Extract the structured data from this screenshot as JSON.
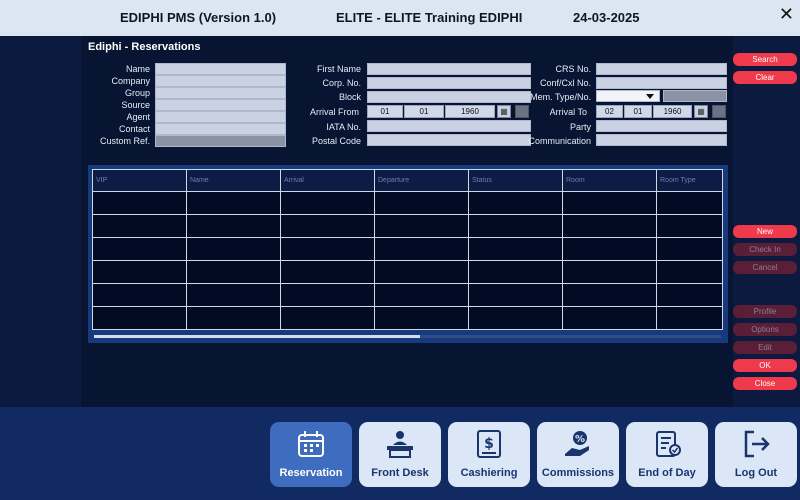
{
  "header": {
    "app": "EDIPHI PMS (Version 1.0)",
    "hotel": "ELITE - ELITE Training EDIPHI",
    "date": "24-03-2025"
  },
  "panel": {
    "title": "Ediphi - Reservations"
  },
  "form": {
    "left": [
      "Name",
      "Company",
      "Group",
      "Source",
      "Agent",
      "Contact",
      "Custom Ref."
    ],
    "mid": {
      "first_name": "First Name",
      "corp_no": "Corp. No.",
      "block": "Block",
      "arrival_from": "Arrival From",
      "iata_no": "IATA No.",
      "postal_code": "Postal Code"
    },
    "right": {
      "crs_no": "CRS No.",
      "conf_cxl_no": "Conf/Cxl No.",
      "mem_type_no": "Mem. Type/No.",
      "arrival_to": "Arrival To",
      "party": "Party",
      "communication": "Communication"
    },
    "arrival_from_date": {
      "day": "01",
      "month": "01",
      "year": "1960"
    },
    "arrival_to_date": {
      "day": "02",
      "month": "01",
      "year": "1960"
    }
  },
  "table": {
    "columns": [
      "VIP",
      "Name",
      "Arrival",
      "Departure",
      "Status",
      "Room",
      "Room Type"
    ],
    "row_count": 6
  },
  "scroll_fraction": 0.52,
  "buttons": {
    "search": "Search",
    "clear": "Clear",
    "new": "New",
    "check_in": "Check In",
    "cancel": "Cancel",
    "profile": "Profile",
    "options": "Options",
    "edit": "Edit",
    "ok": "OK",
    "close": "Close"
  },
  "nav": [
    {
      "label": "Reservation",
      "icon": "calendar-icon",
      "active": true
    },
    {
      "label": "Front Desk",
      "icon": "reception-desk-icon",
      "active": false
    },
    {
      "label": "Cashiering",
      "icon": "receipt-dollar-icon",
      "active": false
    },
    {
      "label": "Commissions",
      "icon": "hand-percent-icon",
      "active": false
    },
    {
      "label": "End of Day",
      "icon": "report-clipboard-icon",
      "active": false
    },
    {
      "label": "Log Out",
      "icon": "logout-icon",
      "active": false
    }
  ],
  "colors": {
    "accent": "#ee3a4a",
    "active_nav": "#3e6cbf",
    "panel": "#081532",
    "background": "#0c1a3f"
  }
}
